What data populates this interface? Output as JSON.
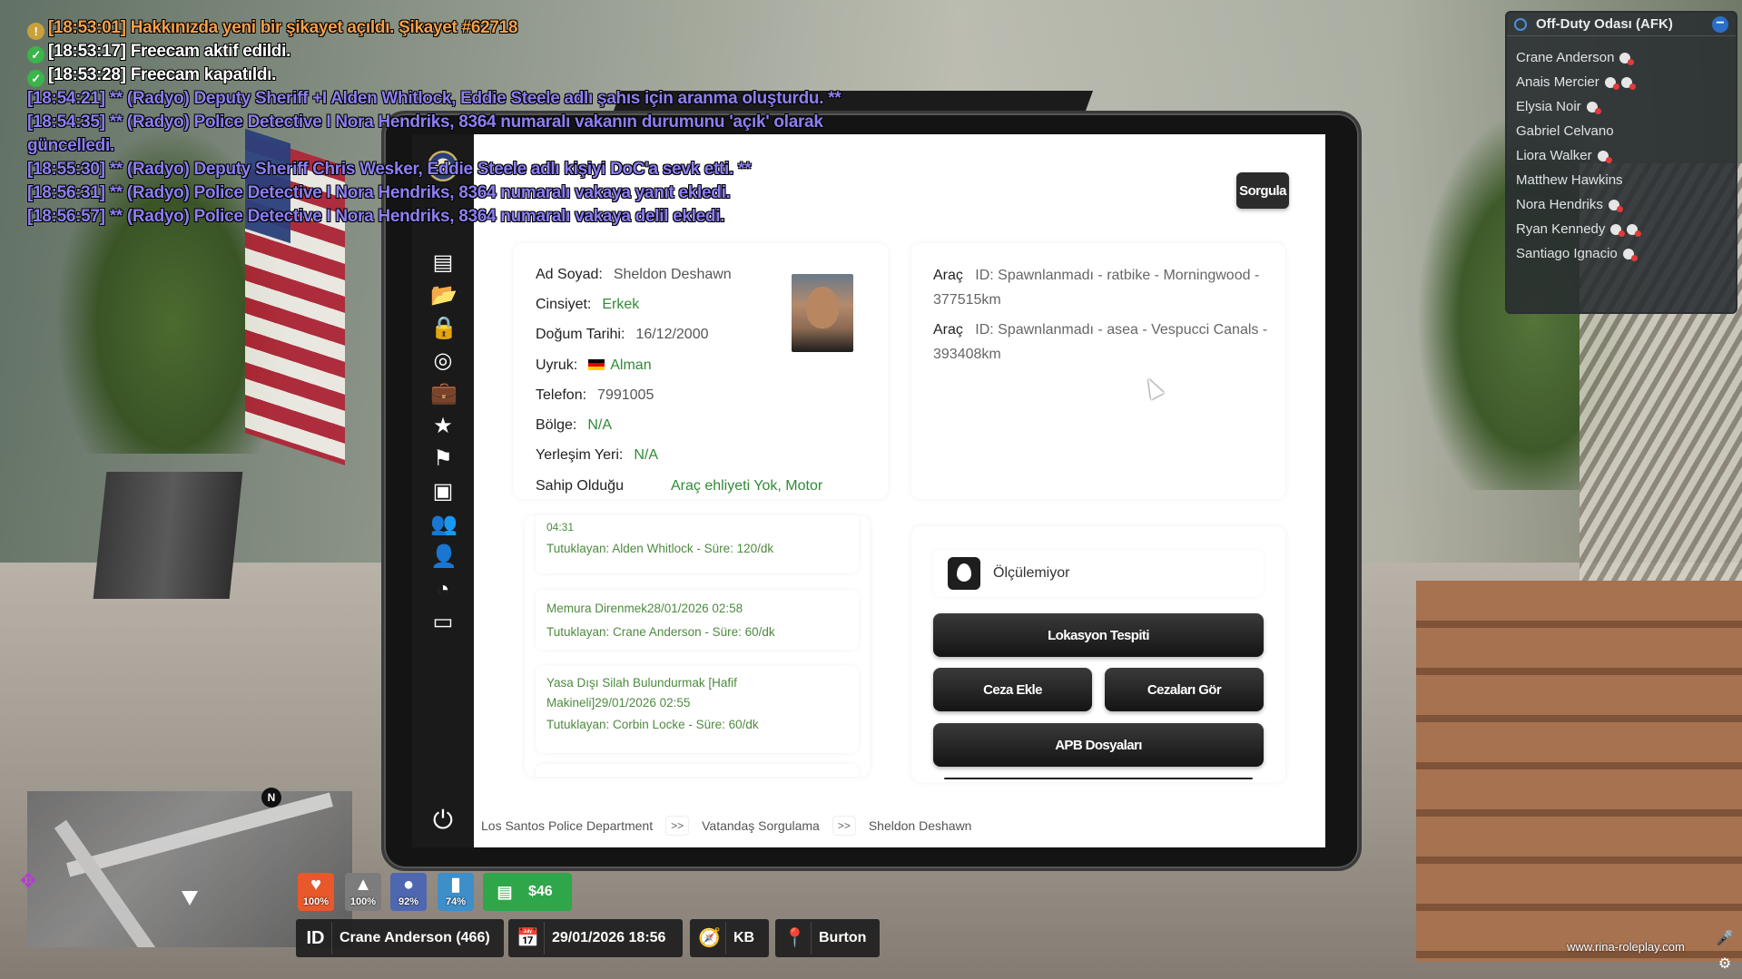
{
  "chat": [
    {
      "cls": "c-orange",
      "icon": "warn",
      "text": "[18:53:01] Hakkınızda yeni bir şikayet açıldı. Şikayet #62718"
    },
    {
      "cls": "c-white",
      "icon": "check",
      "text": "[18:53:17] Freecam aktif edildi."
    },
    {
      "cls": "c-white",
      "icon": "check",
      "text": "[18:53:28] Freecam kapatıldı."
    },
    {
      "cls": "c-purple",
      "icon": "",
      "text": "[18:54:21] ** (Radyo) Deputy Sheriff +I Alden Whitlock, Eddie Steele adlı şahıs için aranma oluşturdu. **"
    },
    {
      "cls": "c-purple",
      "icon": "",
      "text": "[18:54:35] ** (Radyo) Police Detective I Nora Hendriks, 8364 numaralı vakanın durumunu 'açık' olarak güncelledi."
    },
    {
      "cls": "c-purple",
      "icon": "",
      "text": "[18:55:30] ** (Radyo) Deputy Sheriff Chris Wesker, Eddie Steele adlı kişiyi DoC'a sevk etti. **"
    },
    {
      "cls": "c-purple",
      "icon": "",
      "text": "[18:56:31] ** (Radyo) Police Detective I Nora Hendriks, 8364 numaralı vakaya yanıt ekledi."
    },
    {
      "cls": "c-purple",
      "icon": "",
      "text": "[18:56:57] ** (Radyo) Police Detective I Nora Hendriks, 8364 numaralı vakaya delil ekledi."
    }
  ],
  "afk": {
    "title": "Off-Duty Odası (AFK)",
    "members": [
      {
        "name": "Crane Anderson",
        "tags": 1
      },
      {
        "name": "Anais Mercier",
        "tags": 2
      },
      {
        "name": "Elysia Noir",
        "tags": 1
      },
      {
        "name": "Gabriel Celvano",
        "tags": 0
      },
      {
        "name": "Liora Walker",
        "tags": 1
      },
      {
        "name": "Matthew Hawkins",
        "tags": 0
      },
      {
        "name": "Nora Hendriks",
        "tags": 1
      },
      {
        "name": "Ryan Kennedy",
        "tags": 2
      },
      {
        "name": "Santiago Ignacio",
        "tags": 1
      }
    ]
  },
  "tablet": {
    "search_button": "Sorgula",
    "sidebar_icons": [
      "document-icon",
      "folder-icon",
      "lock-icon",
      "binoculars-icon",
      "briefcase-icon",
      "star-icon",
      "flag-icon",
      "suitcase-icon",
      "users-icon",
      "user-icon",
      "gauge-icon",
      "archive-icon"
    ],
    "profile": {
      "name_label": "Ad Soyad:",
      "name": "Sheldon Deshawn",
      "gender_label": "Cinsiyet:",
      "gender": "Erkek",
      "dob_label": "Doğum Tarihi:",
      "dob": "16/12/2000",
      "nationality_label": "Uyruk:",
      "nationality": "Alman",
      "phone_label": "Telefon:",
      "phone": "7991005",
      "region_label": "Bölge:",
      "region": "N/A",
      "residence_label": "Yerleşim Yeri:",
      "residence": "N/A",
      "owned_label": "Sahip Olduğu",
      "owned": "Araç ehliyeti Yok, Motor"
    },
    "vehicles": [
      {
        "label": "Araç",
        "value": "ID: Spawnlanmadı - ratbike - Morningwood - 377515km"
      },
      {
        "label": "Araç",
        "value": "ID: Spawnlanmadı - asea - Vespucci Canals - 393408km"
      }
    ],
    "records": [
      {
        "top": "04:31",
        "bottom": "Tutuklayan: Alden Whitlock - Süre: 120/dk"
      },
      {
        "top": "Memura Direnmek28/01/2026 02:58",
        "bottom": "Tutuklayan: Crane Anderson - Süre: 60/dk"
      },
      {
        "top": "Yasa Dışı Silah Bulundurmak [Hafif Makineli]29/01/2026 02:55",
        "bottom": "Tutuklayan: Corbin Locke - Süre: 60/dk"
      }
    ],
    "location_status": "Ölçülemiyor",
    "buttons": {
      "location": "Lokasyon Tespiti",
      "add_fine": "Ceza Ekle",
      "view_fines": "Cezaları Gör",
      "apb": "APB Dosyaları"
    },
    "breadcrumb": [
      "Los Santos Police Department",
      "Vatandaş Sorgulama",
      "Sheldon Deshawn"
    ],
    "breadcrumb_sep": ">>"
  },
  "hud": {
    "health": "100%",
    "armor": "100%",
    "hunger": "92%",
    "thirst": "74%",
    "money": "$46",
    "player": "Crane Anderson (466)",
    "id_label": "ID",
    "datetime": "29/01/2026 18:56",
    "heading": "KB",
    "location": "Burton",
    "north": "N"
  },
  "watermark": "www.rina-roleplay.com"
}
